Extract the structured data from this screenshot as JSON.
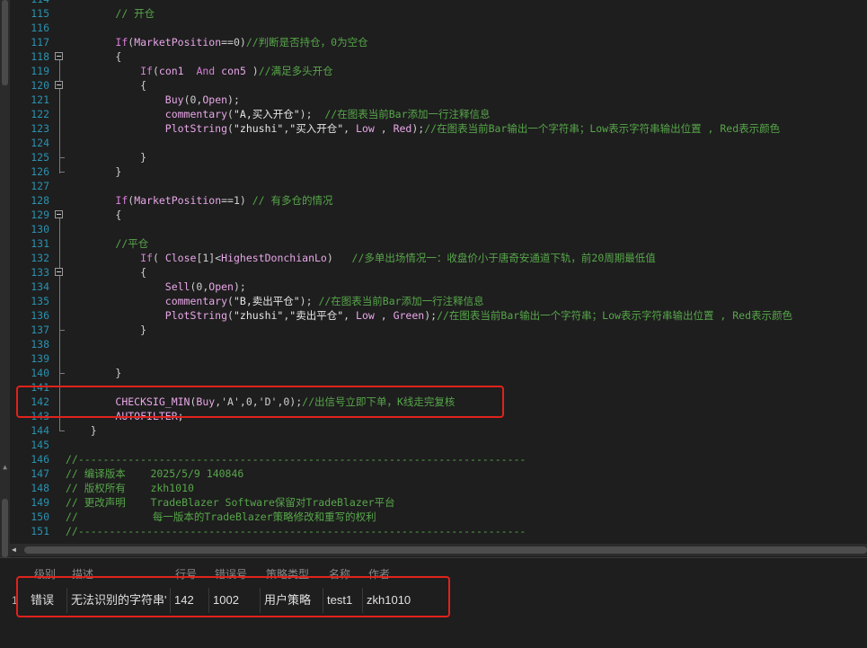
{
  "editor": {
    "lines": [
      {
        "n": "114",
        "text": ""
      },
      {
        "n": "115",
        "text": "        // 开仓"
      },
      {
        "n": "116",
        "text": ""
      },
      {
        "n": "117",
        "text": "        If(MarketPosition==0)//判断是否持仓，0为空仓"
      },
      {
        "n": "118",
        "text": "        {"
      },
      {
        "n": "119",
        "text": "            If(con1  And con5 )//满足多头开仓"
      },
      {
        "n": "120",
        "text": "            {"
      },
      {
        "n": "121",
        "text": "                Buy(0,Open);"
      },
      {
        "n": "122",
        "text": "                commentary(\"A,买入开仓\");  //在图表当前Bar添加一行注释信息"
      },
      {
        "n": "123",
        "text": "                PlotString(\"zhushi\",\"买入开仓\", Low , Red);//在图表当前Bar输出一个字符串；Low表示字符串输出位置 , Red表示颜色"
      },
      {
        "n": "124",
        "text": ""
      },
      {
        "n": "125",
        "text": "            }"
      },
      {
        "n": "126",
        "text": "        }"
      },
      {
        "n": "127",
        "text": ""
      },
      {
        "n": "128",
        "text": "        If(MarketPosition==1) // 有多仓的情况"
      },
      {
        "n": "129",
        "text": "        {"
      },
      {
        "n": "130",
        "text": ""
      },
      {
        "n": "131",
        "text": "        //平仓"
      },
      {
        "n": "132",
        "text": "            If( Close[1]<HighestDonchianLo)   //多单出场情况一：收盘价小于唐奇安通道下轨，前20周期最低值"
      },
      {
        "n": "133",
        "text": "            {"
      },
      {
        "n": "134",
        "text": "                Sell(0,Open);"
      },
      {
        "n": "135",
        "text": "                commentary(\"B,卖出平仓\"); //在图表当前Bar添加一行注释信息"
      },
      {
        "n": "136",
        "text": "                PlotString(\"zhushi\",\"卖出平仓\", Low , Green);//在图表当前Bar输出一个字符串；Low表示字符串输出位置 , Red表示颜色"
      },
      {
        "n": "137",
        "text": "            }"
      },
      {
        "n": "138",
        "text": ""
      },
      {
        "n": "139",
        "text": ""
      },
      {
        "n": "140",
        "text": "        }"
      },
      {
        "n": "141",
        "text": ""
      },
      {
        "n": "142",
        "text": "        CHECKSIG_MIN(Buy,'A',0,'D',0);//出信号立即下单，K线走完复核"
      },
      {
        "n": "143",
        "text": "        AUTOFILTER;"
      },
      {
        "n": "144",
        "text": "    }"
      },
      {
        "n": "145",
        "text": ""
      },
      {
        "n": "146",
        "text": "//------------------------------------------------------------------------"
      },
      {
        "n": "147",
        "text": "// 编译版本    2025/5/9 140846"
      },
      {
        "n": "148",
        "text": "// 版权所有    zkh1010"
      },
      {
        "n": "149",
        "text": "// 更改声明    TradeBlazer Software保留对TradeBlazer平台"
      },
      {
        "n": "150",
        "text": "//            每一版本的TradeBlazer策略修改和重写的权利"
      },
      {
        "n": "151",
        "text": "//------------------------------------------------------------------------"
      }
    ]
  },
  "errors": {
    "headers": [
      "级别",
      "描述",
      "行号",
      "错误号",
      "策略类型",
      "名称",
      "作者"
    ],
    "row_index": "1",
    "rows": [
      {
        "level": "错误",
        "desc": "无法识别的字符串'",
        "line": "142",
        "code": "1002",
        "type": "用户策略",
        "name": "test1",
        "author": "zkh1010"
      }
    ]
  },
  "colors": {
    "highlight": "#e0221c",
    "keyword": "#d77fd7",
    "comment": "#57a64a",
    "line_number": "#2b91af"
  }
}
